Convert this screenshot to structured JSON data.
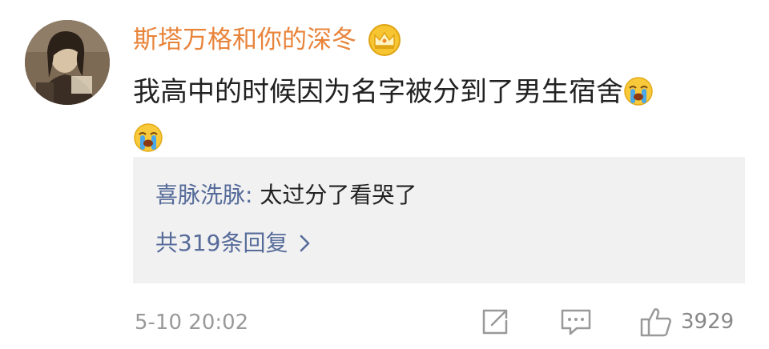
{
  "comment": {
    "username": "斯塔万格和你的深冬",
    "text": "我高中的时候因为名字被分到了男生宿舍",
    "emoji": "crying-emoji"
  },
  "reply": {
    "author": "喜脉洗脉",
    "colon": ":",
    "text": "太过分了看哭了",
    "more_label": "共319条回复"
  },
  "footer": {
    "timestamp": "5-10 20:02",
    "like_count": "3929"
  },
  "icons": {
    "badge": "crown-badge-icon",
    "share": "share-icon",
    "comment": "comment-icon",
    "like": "thumbs-up-icon",
    "more": "chevron-right-icon"
  },
  "colors": {
    "username": "#e8833a",
    "reply_link": "#566b9a",
    "reply_bg": "#f1f1f1",
    "meta": "#999999"
  }
}
